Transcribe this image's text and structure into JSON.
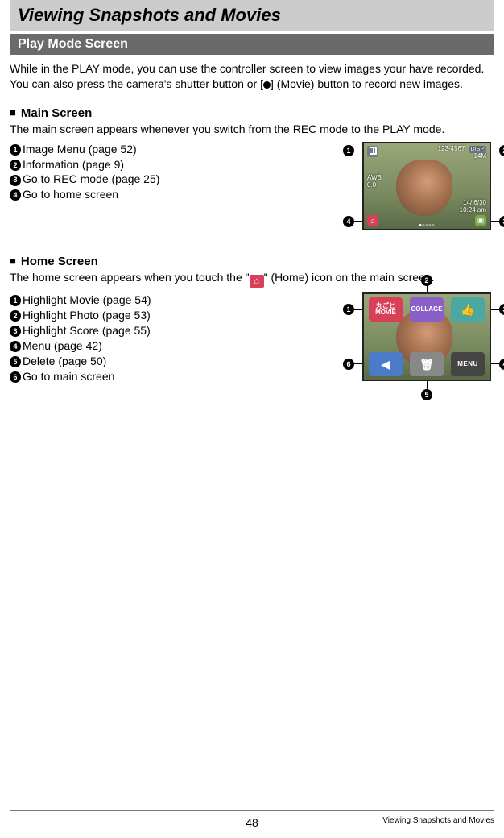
{
  "chapter_title": "Viewing Snapshots and Movies",
  "section_title": "Play Mode Screen",
  "intro_text_1": "While in the PLAY mode, you can use the controller screen to view images your have recorded. You can also press the camera's shutter button or [",
  "intro_text_2": "] (Movie) button to record new images.",
  "main_screen": {
    "heading": "Main Screen",
    "desc": "The main screen appears whenever you switch from the REC mode to the PLAY mode.",
    "items": [
      "Image Menu (page 52)",
      "Information (page 9)",
      "Go to REC mode (page 25)",
      "Go to home screen"
    ],
    "overlay": {
      "file_no": "123-4567",
      "resolution": "14M",
      "disp": "DISP",
      "awb": "AWB",
      "ev": "0.0",
      "date": "14/ 6/30",
      "time": "10:24 am"
    }
  },
  "home_screen": {
    "heading": "Home Screen",
    "desc_1": "The home screen appears when you touch the \"",
    "desc_2": "\" (Home) icon on the main screen.",
    "items": [
      "Highlight Movie (page 54)",
      "Highlight Photo (page 53)",
      "Highlight Score (page 55)",
      "Menu (page 42)",
      "Delete (page 50)",
      "Go to main screen"
    ],
    "buttons": {
      "movie_top": "丸ごと",
      "movie_bottom": "MOVIE",
      "collage": "COLLAGE",
      "thumb": "👍",
      "back": "◀",
      "trash": "🗑",
      "menu": "MENU"
    }
  },
  "footer": {
    "page": "48",
    "right": "Viewing Snapshots and Movies"
  }
}
